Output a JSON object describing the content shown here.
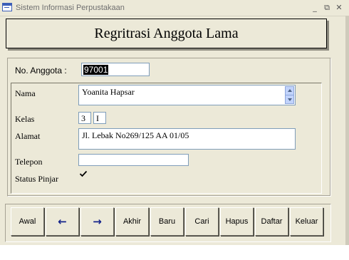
{
  "window": {
    "title": "Sistem Informasi Perpustakaan",
    "controls": {
      "minimize": "_",
      "restore": "⧉",
      "close": "✕"
    }
  },
  "form": {
    "heading": "Regritrasi Anggota Lama",
    "no_anggota_label": "No. Anggota :",
    "no_anggota_value": "97001",
    "fields": {
      "nama": {
        "label": "Nama",
        "value": "Yoanita Hapsar"
      },
      "kelas": {
        "label": "Kelas",
        "value1": "3",
        "value2": "I"
      },
      "alamat": {
        "label": "Alamat",
        "value": "Jl. Lebak No269/125 AA 01/05"
      },
      "telepon": {
        "label": "Telepon",
        "value": ""
      },
      "status_pinjar": {
        "label": "Status Pinjar",
        "checked": true
      }
    }
  },
  "buttons": {
    "awal": "Awal",
    "prev": "←",
    "next": "→",
    "akhir": "Akhir",
    "baru": "Baru",
    "cari": "Cari",
    "hapus": "Hapus",
    "daftar": "Daftar",
    "keluar": "Keluar"
  },
  "icons": {
    "app": "form-icon",
    "scroll_up": "scroll-up-arrow-icon",
    "scroll_down": "scroll-down-arrow-icon",
    "checkbox": "checkmark-icon"
  }
}
